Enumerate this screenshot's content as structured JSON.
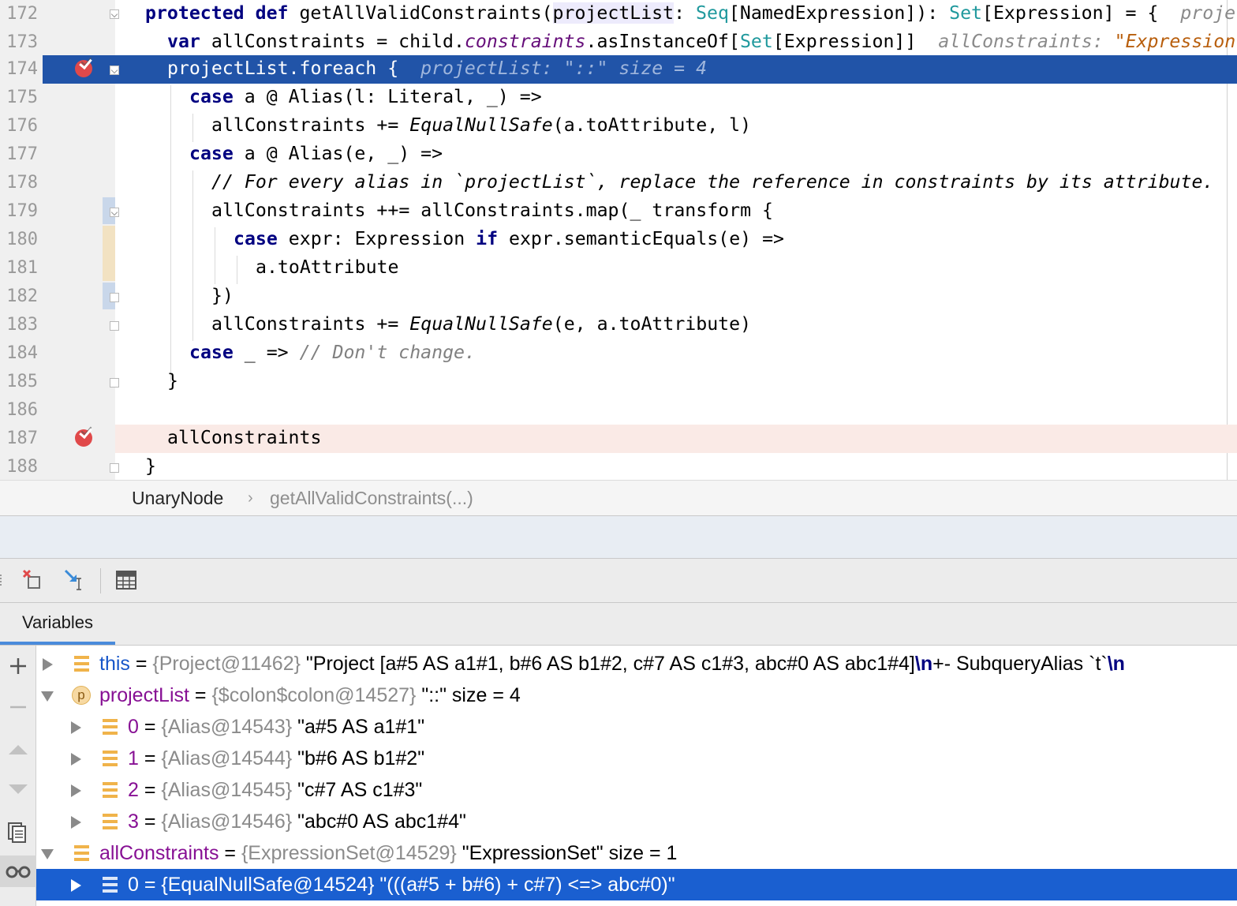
{
  "editor": {
    "lines": [
      {
        "n": "172"
      },
      {
        "n": "173"
      },
      {
        "n": "174"
      },
      {
        "n": "175"
      },
      {
        "n": "176"
      },
      {
        "n": "177"
      },
      {
        "n": "178"
      },
      {
        "n": "179"
      },
      {
        "n": "180"
      },
      {
        "n": "181"
      },
      {
        "n": "182"
      },
      {
        "n": "183"
      },
      {
        "n": "184"
      },
      {
        "n": "185"
      },
      {
        "n": "186"
      },
      {
        "n": "187"
      },
      {
        "n": "188"
      }
    ],
    "t": {
      "protected": "protected",
      "def": "def",
      "fn_sig_1": " getAllValidConstraints(",
      "projectList": "projectList",
      "colon_sp": ": ",
      "Seq": "Seq",
      "named_expr": "[NamedExpression]): ",
      "Set": "Set",
      "expr_eq": "[Expression] = {  ",
      "hint172": "proje",
      "var": "var",
      "l173_a": " allConstraints = child.",
      "constraints": "constraints",
      "l173_b": ".asInstanceOf[",
      "Set2": "Set",
      "l173_c": "[Expression]]  ",
      "hint173_name": "allConstraints: ",
      "hint173_val": "\"Expression",
      "l174": "projectList.foreach {  ",
      "hint174": "projectList: \"::\" size = 4",
      "case": "case",
      "l175": " a @ Alias(l: Literal, _) =>",
      "l176_a": "allConstraints += ",
      "EqualNullSafe": "EqualNullSafe",
      "l176_b": "(a.toAttribute, l)",
      "l177": " a @ Alias(e, _) =>",
      "l178": "// For every alias in `projectList`, replace the reference in constraints by its attribute.",
      "l179": "allConstraints ++= allConstraints.map(_ transform {",
      "l180_a": " expr: Expression ",
      "if": "if",
      "l180_b": " expr.semanticEquals(e) =>",
      "l181": "a.toAttribute",
      "l182": "})",
      "l183_a": "allConstraints += ",
      "l183_b": "(e, a.toAttribute)",
      "l184_a": " _ => ",
      "l184_cmt": "// Don't change.",
      "l185": "}",
      "l187": "allConstraints",
      "l188": "}"
    }
  },
  "breadcrumb": {
    "item1": "UnaryNode",
    "sep": "›",
    "item2": "getAllValidConstraints(...)"
  },
  "debugger": {
    "tab_label": "Variables",
    "toolbar_icons": [
      "remove-watch-icon",
      "step-into-icon",
      "table-view-icon"
    ],
    "rail_icons": [
      "add-watch-icon",
      "minus-icon",
      "up-arrow-icon",
      "down-arrow-icon",
      "copy-icon",
      "glasses-icon"
    ],
    "vars": {
      "this_name": "this",
      "this_type": "{Project@11462}",
      "this_val_a": " \"Project [a#5 AS a1#1, b#6 AS b1#2, c#7 AS c1#3, abc#0 AS abc1#4]",
      "this_nl": "\\n",
      "this_val_b": "+- SubqueryAlias `t`",
      "this_nl2": "\\n",
      "param_badge": "p",
      "pl_name": "projectList",
      "pl_type": "{$colon$colon@14527}",
      "pl_val": " \"::\" size = 4",
      "items": [
        {
          "idx": "0",
          "type": "{Alias@14543}",
          "val": " \"a#5 AS a1#1\""
        },
        {
          "idx": "1",
          "type": "{Alias@14544}",
          "val": " \"b#6 AS b1#2\""
        },
        {
          "idx": "2",
          "type": "{Alias@14545}",
          "val": " \"c#7 AS c1#3\""
        },
        {
          "idx": "3",
          "type": "{Alias@14546}",
          "val": " \"abc#0 AS abc1#4\""
        }
      ],
      "ac_name": "allConstraints",
      "ac_type": "{ExpressionSet@14529}",
      "ac_val": " \"ExpressionSet\" size = 1",
      "sel_idx": "0",
      "sel_type": "{EqualNullSafe@14524}",
      "sel_val": " \"(((a#5 + b#6) + c#7) <=> abc#0)\"",
      "eq": " = "
    }
  },
  "colors": {
    "exec_line": "#2154a8",
    "selection": "#1a5fd0",
    "breakpoint": "#e0494a",
    "keyword": "#000080",
    "accent_tab": "#4a8bdb"
  }
}
